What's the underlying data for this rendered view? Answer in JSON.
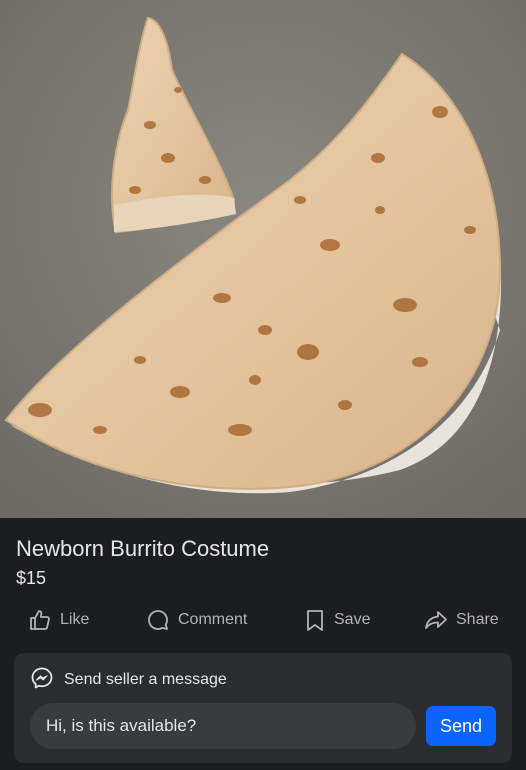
{
  "listing": {
    "title": "Newborn Burrito Costume",
    "price": "$15"
  },
  "actions": [
    {
      "label": "Like",
      "icon": "thumbs-up-icon"
    },
    {
      "label": "Comment",
      "icon": "comment-icon"
    },
    {
      "label": "Save",
      "icon": "bookmark-icon"
    },
    {
      "label": "Share",
      "icon": "share-icon"
    }
  ],
  "message": {
    "header": "Send seller a message",
    "icon": "messenger-icon",
    "input_value": "Hi, is this available?",
    "send_label": "Send"
  },
  "colors": {
    "background": "#1c1d1f",
    "panel": "#2b2c30",
    "input": "#3a3b3f",
    "accent": "#0866ff",
    "muted_text": "#b0b3b8"
  }
}
